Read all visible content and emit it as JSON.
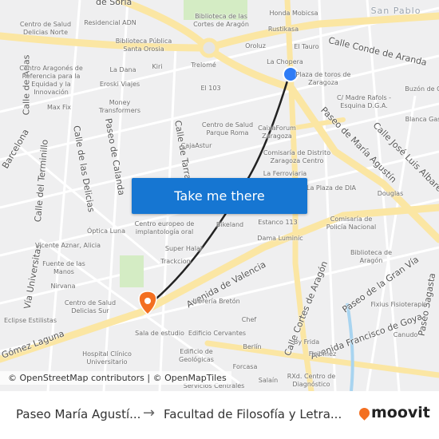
{
  "map": {
    "district": "San Pablo",
    "streets": [
      "Calle Conde de Aranda",
      "Paseo de María Agustín",
      "Calle José Luis Albareda",
      "Avenida de Valencia",
      "Calle Cortes de Aragón",
      "Avenida Francisco de Goya",
      "Paseo de la Gran Vía",
      "Paseo Sagasta",
      "Calle de Arias",
      "Barcelona",
      "Calle del Terminillo",
      "Calle de las Delicias",
      "Paseo de Calanda",
      "Vía Universitas",
      "Gómez Laguna",
      "de Soria",
      "Calle de Tarragona"
    ],
    "pois": [
      "Centro de Salud Delicias Norte",
      "Residencial ADN",
      "Biblioteca de las Cortes de Aragón",
      "Honda Mobicsa",
      "Rustikasa",
      "Biblioteca Pública Santa Orosia",
      "Oroluz",
      "El Tauro",
      "La Chopera",
      "Trelomé",
      "Kiri",
      "La Dana",
      "Centro Aragonés de Referencia para la Equidad y la Innovación",
      "Eroski Viajes",
      "Plaza de toros de Zaragoza",
      "El 103",
      "Money Transformers",
      "Max Fix",
      "C/ Madre Rafols - Esquina D.G.A.",
      "Buzón de C",
      "Blanca Gas",
      "Centro de Salud Parque Roma",
      "CaixaForum Zaragoza",
      "CajaAstur",
      "Comisaría de Distrito Zaragoza Centro",
      "La Ferroviaria",
      "La Plaza de DIA",
      "Douglas",
      "Estanco 113",
      "Bikeland",
      "Centro europeo de implantología oral",
      "Óptica Luna",
      "Comisaría de Policía Nacional",
      "Dama Luminic",
      "Vicente Aznar, Alicia",
      "Super Halal",
      "Fuente de las Manos",
      "Trackcion",
      "Biblioteca de Aragón",
      "Nirvana",
      "Centro de Salud Delicias Sur",
      "Librería Bretón",
      "Fixius Fisioterapia",
      "Eclipse Estilistas",
      "Chef",
      "Sala de estudio",
      "Edificio Cervantes",
      "Canudo",
      "Berlín",
      "By Frida",
      "Hospital Clínico Universitario",
      "Edificio de Geológicas",
      "Fisiomez",
      "Forcasa",
      "Salaín",
      "RXd. Centro de Diagnóstico",
      "Servicios Centrales"
    ],
    "route_color": "#222222",
    "origin_color": "#2f7cf6",
    "destination_color": "#f36f21"
  },
  "cta": {
    "label": "Take me there"
  },
  "attribution": "© OpenStreetMap contributors | © OpenMapTiles",
  "footer": {
    "from": "Paseo María Agustí...",
    "arrow": "→",
    "to": "Facultad de Filosofía y Letra...",
    "brand": "moovit"
  }
}
